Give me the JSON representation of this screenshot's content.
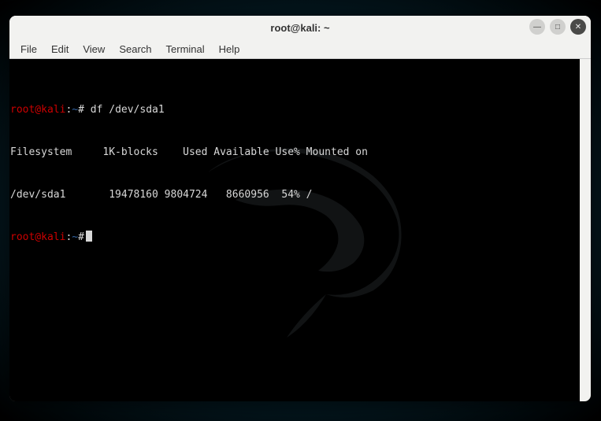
{
  "window": {
    "title": "root@kali: ~"
  },
  "menubar": {
    "items": [
      "File",
      "Edit",
      "View",
      "Search",
      "Terminal",
      "Help"
    ]
  },
  "prompt": {
    "user_host": "root@kali",
    "separator": ":",
    "path": "~",
    "symbol": "#"
  },
  "terminal": {
    "command": "df /dev/sda1",
    "header": "Filesystem     1K-blocks    Used Available Use% Mounted on",
    "row": "/dev/sda1       19478160 9804724   8660956  54% /"
  },
  "icons": {
    "minimize": "—",
    "maximize": "□",
    "close": "✕"
  }
}
